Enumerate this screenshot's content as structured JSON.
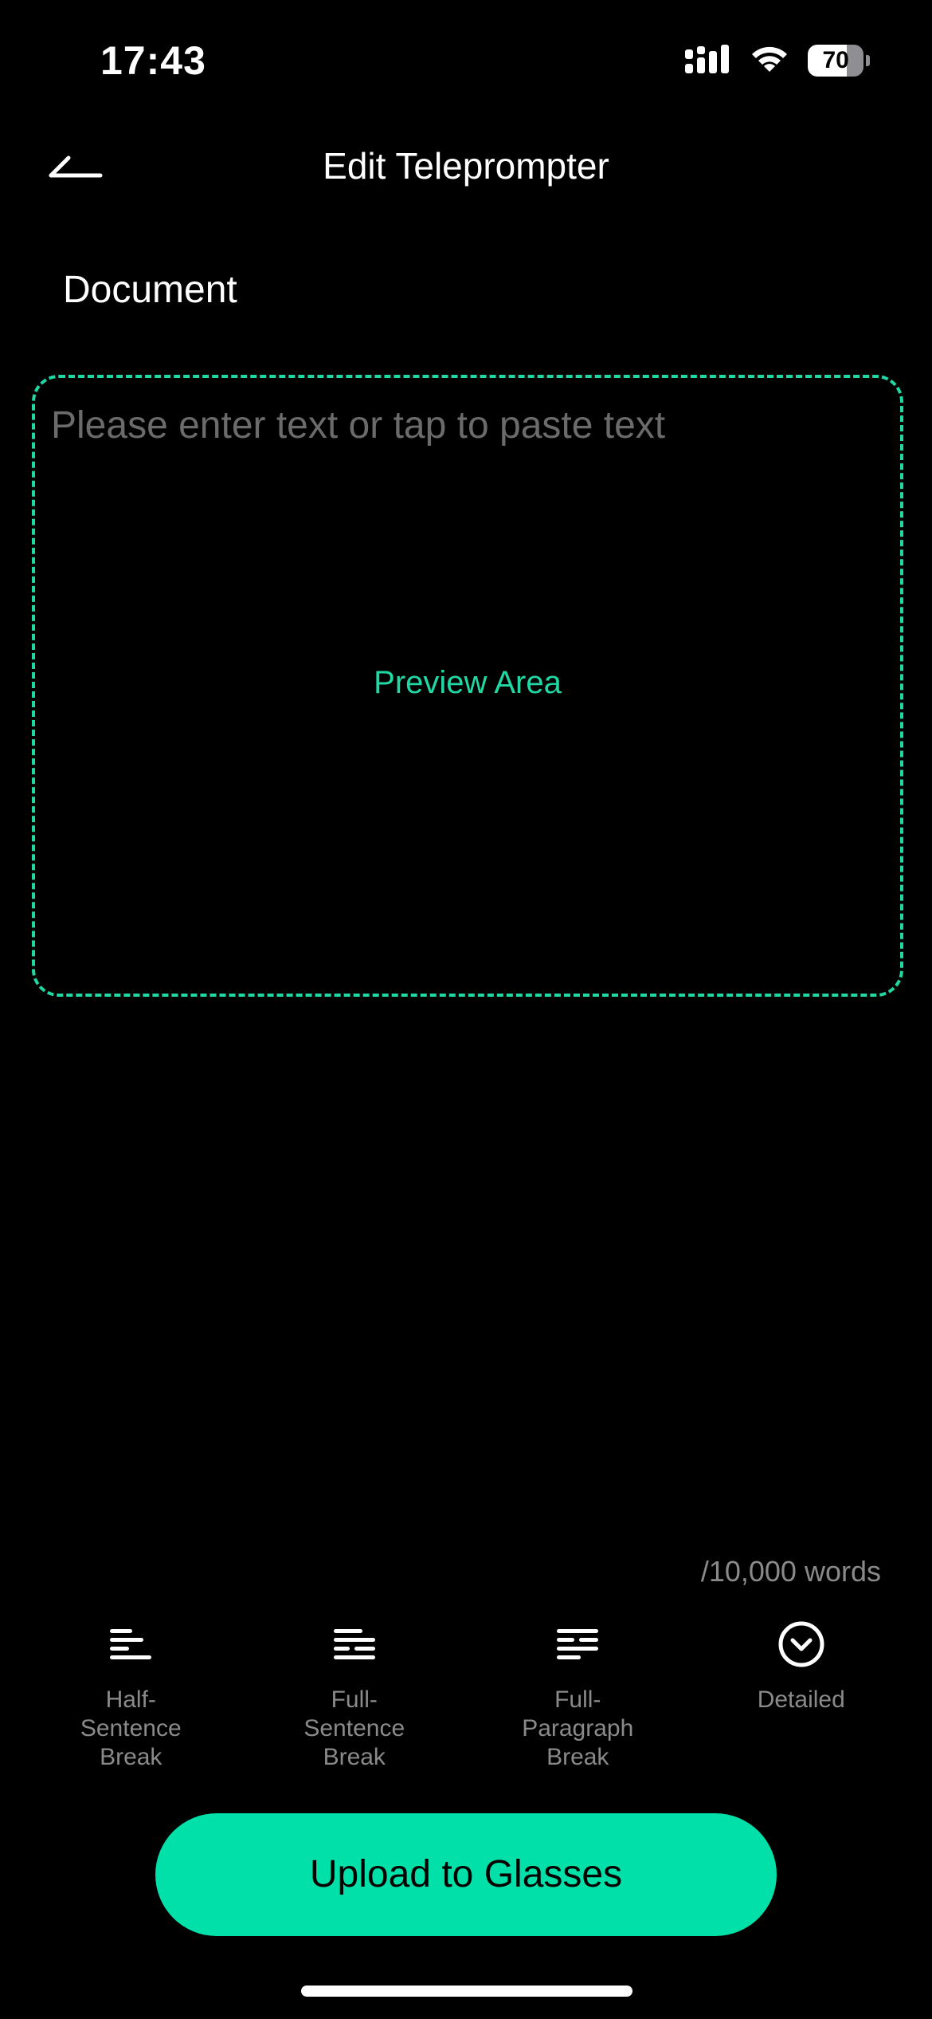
{
  "status_bar": {
    "time": "17:43",
    "battery_level": "70",
    "battery_fraction": 0.7,
    "signal_icon": "cellular-signal-icon",
    "wifi_icon": "wifi-icon"
  },
  "header": {
    "back_icon": "back-arrow-icon",
    "title": "Edit Teleprompter"
  },
  "document": {
    "label": "Document",
    "placeholder": "Please enter text or tap to paste text",
    "preview_label": "Preview Area",
    "word_count": "/10,000 words"
  },
  "break_options": [
    {
      "label": "Half-\nSentence\nBreak",
      "icon": "half-sentence-break-icon"
    },
    {
      "label": "Full-\nSentence\nBreak",
      "icon": "full-sentence-break-icon"
    },
    {
      "label": "Full-\nParagraph\nBreak",
      "icon": "full-paragraph-break-icon"
    },
    {
      "label": "Detailed",
      "icon": "chevron-down-circle-icon"
    }
  ],
  "upload_button": {
    "label": "Upload to Glasses"
  },
  "colors": {
    "accent": "#00e0a8",
    "dashed_border": "#1fd8a4",
    "background": "#000000",
    "muted_text": "#8a8a8a"
  }
}
